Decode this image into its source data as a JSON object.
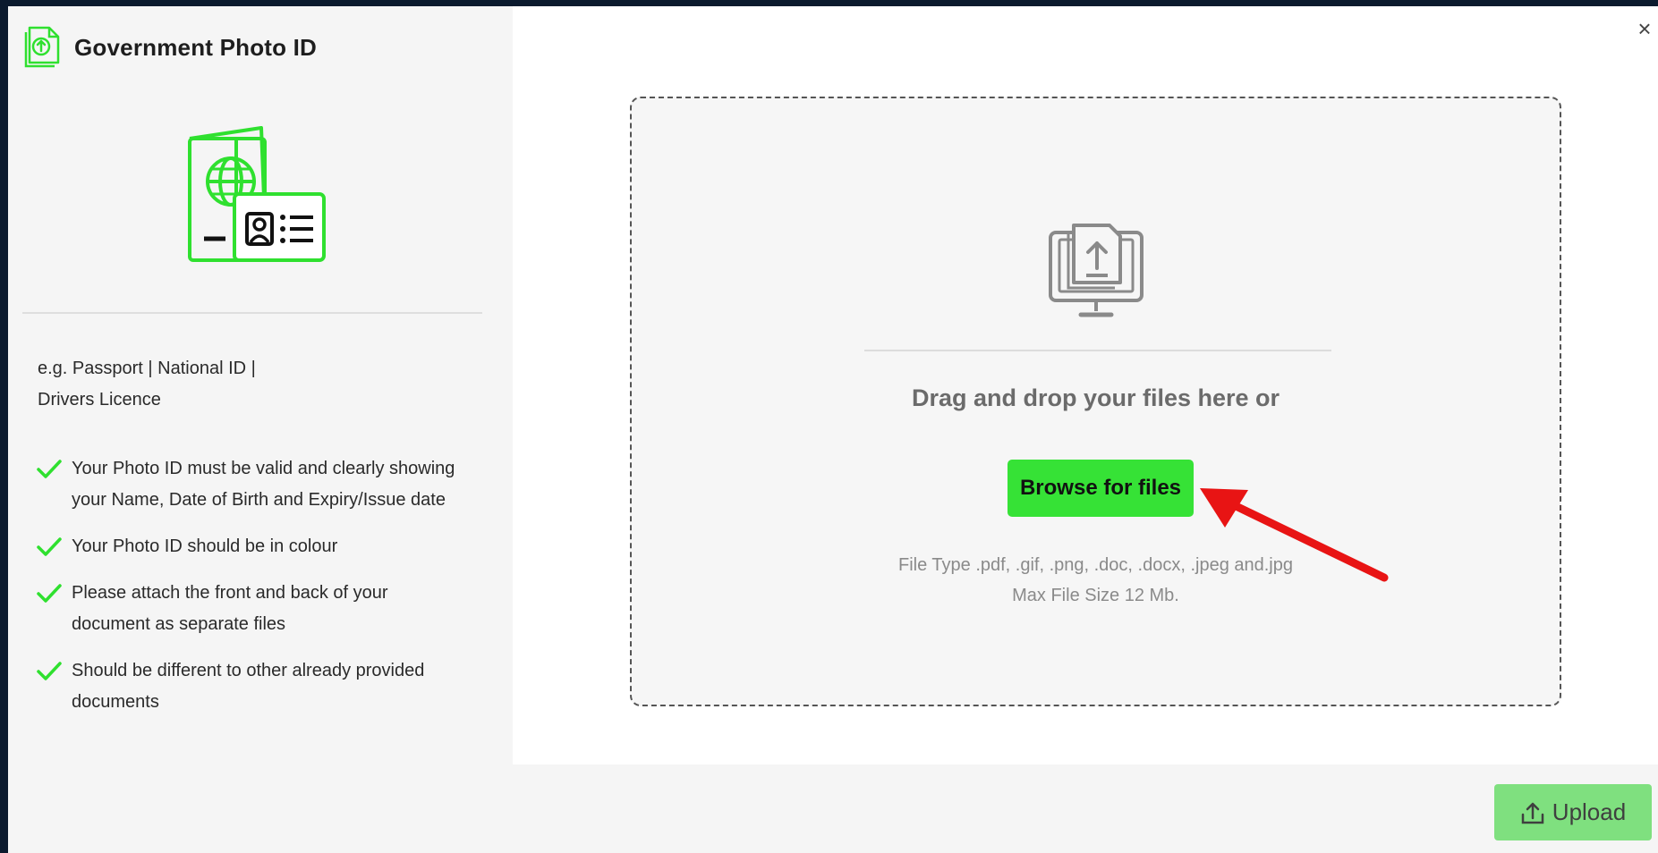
{
  "header": {
    "title": "Government Photo ID",
    "icon": "document-upload-icon"
  },
  "sidebar": {
    "examples_line1": "e.g. Passport | National ID |",
    "examples_line2": "Drivers Licence",
    "requirements": [
      {
        "line1": "Your Photo ID must be valid and clearly showing",
        "line2": "your Name, Date of Birth and Expiry/Issue date"
      },
      {
        "line1": "Your Photo ID should be in colour",
        "line2": ""
      },
      {
        "line1": "Please attach the front and back of your",
        "line2": "document as separate files"
      },
      {
        "line1": "Should be different to other already provided",
        "line2": "documents"
      }
    ],
    "illustration_icon": "passport-id-card-icon"
  },
  "dropzone": {
    "prompt": "Drag and drop your files here or",
    "browse_label": "Browse for files",
    "file_types": "File Type .pdf, .gif, .png, .doc, .docx, .jpeg and.jpg",
    "max_size": "Max File Size 12 Mb.",
    "icon": "monitor-upload-icon"
  },
  "footer": {
    "upload_label": "Upload"
  },
  "close_label": "×",
  "colors": {
    "accent_green": "#36e236",
    "icon_green": "#2fe02f",
    "upload_button": "#7fe07f",
    "annotation_arrow": "#e81414"
  }
}
